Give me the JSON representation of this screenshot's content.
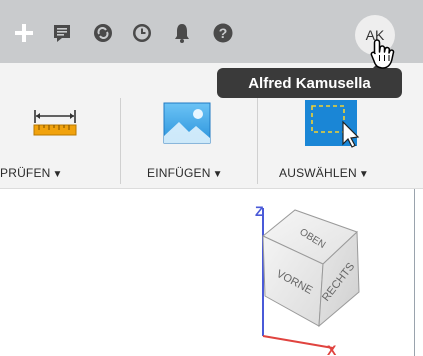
{
  "toolbar": {
    "icons": [
      "plus-icon",
      "comment-icon",
      "job-status-icon",
      "clock-icon",
      "bell-icon",
      "help-icon"
    ],
    "avatar_initials": "AK"
  },
  "tooltip": {
    "text": "Alfred Kamusella"
  },
  "ribbon": {
    "tools": [
      {
        "label": "PRÜFEN",
        "icon": "measure-ruler-icon"
      },
      {
        "label": "EINFÜGEN",
        "icon": "insert-image-icon"
      },
      {
        "label": "AUSWÄHLEN",
        "icon": "select-cursor-icon"
      }
    ]
  },
  "viewcube": {
    "face_top": "OBEN",
    "face_front": "VORNE",
    "face_right": "RECHTS",
    "axis_z": "Z",
    "axis_x": "X"
  },
  "colors": {
    "topbar_bg": "#c9cbcd",
    "select_blue": "#1a86d6",
    "axis_z": "#4a5ad8",
    "axis_x": "#e0433f"
  }
}
